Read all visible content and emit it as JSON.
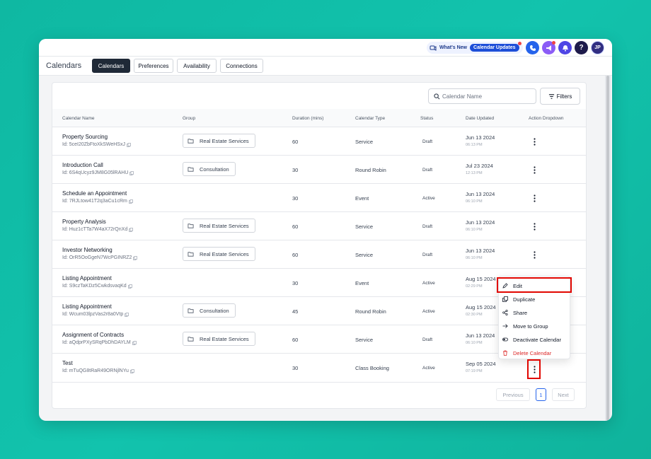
{
  "topbar": {
    "whats_new_label": "What's New",
    "updates_label": "Calendar Updates",
    "avatar_initials": "JP",
    "help_label": "?"
  },
  "header": {
    "title": "Calendars",
    "tabs": [
      {
        "label": "Calendars",
        "active": true
      },
      {
        "label": "Preferences",
        "active": false
      },
      {
        "label": "Availability",
        "active": false
      },
      {
        "label": "Connections",
        "active": false
      }
    ]
  },
  "toolbar": {
    "search_placeholder": "Calendar Name",
    "filters_label": "Filters"
  },
  "table": {
    "columns": [
      "Calendar Name",
      "Group",
      "Duration (mins)",
      "Calendar Type",
      "Status",
      "Date Updated",
      "Action Dropdown"
    ],
    "rows": [
      {
        "name": "Property Sourcing",
        "id": "Id: 5ceI20ZbFtoXkSWeHSxJ",
        "group": "Real Estate Services",
        "duration": "60",
        "type": "Service",
        "status": "Draft",
        "date": "Jun 13 2024",
        "time": "06:13 PM"
      },
      {
        "name": "Introduction Call",
        "id": "Id: 6S4qUcyz9JM8G05lRAHU",
        "group": "Consultation",
        "duration": "30",
        "type": "Round Robin",
        "status": "Draft",
        "date": "Jul 23 2024",
        "time": "12:13 PM"
      },
      {
        "name": "Schedule an Appointment",
        "id": "Id: 7RJLtow41T2q3aCu1cRm",
        "group": "",
        "duration": "30",
        "type": "Event",
        "status": "Active",
        "date": "Jun 13 2024",
        "time": "06:10 PM"
      },
      {
        "name": "Property Analysis",
        "id": "Id: Huz1cTTa7W4aX72rQnXd",
        "group": "Real Estate Services",
        "duration": "60",
        "type": "Service",
        "status": "Draft",
        "date": "Jun 13 2024",
        "time": "06:10 PM"
      },
      {
        "name": "Investor Networking",
        "id": "Id: OrR5OoGgeN7WcPGINRZ2",
        "group": "Real Estate Services",
        "duration": "60",
        "type": "Service",
        "status": "Draft",
        "date": "Jun 13 2024",
        "time": "06:10 PM"
      },
      {
        "name": "Listing Appointment",
        "id": "Id: S9czTaKDz5CwkdsvaqKd",
        "group": "",
        "duration": "30",
        "type": "Event",
        "status": "Active",
        "date": "Aug 15 2024",
        "time": "02:29 PM"
      },
      {
        "name": "Listing Appointment",
        "id": "Id: Wcum03lpzVas2r8a0Vtp",
        "group": "Consultation",
        "duration": "45",
        "type": "Round Robin",
        "status": "Active",
        "date": "Aug 15 2024",
        "time": "02:30 PM"
      },
      {
        "name": "Assignment of Contracts",
        "id": "Id: aQdprPXySRqPbDhDAYLM",
        "group": "Real Estate Services",
        "duration": "60",
        "type": "Service",
        "status": "Draft",
        "date": "Jun 13 2024",
        "time": "06:10 PM"
      },
      {
        "name": "Test",
        "id": "Id: mTuQG8tRaR49ORNjlNYu",
        "group": "",
        "duration": "30",
        "type": "Class Booking",
        "status": "Active",
        "date": "Sep 05 2024",
        "time": "07:19 PM"
      }
    ]
  },
  "pagination": {
    "previous": "Previous",
    "page": "1",
    "next": "Next"
  },
  "action_menu": {
    "items": [
      {
        "label": "Edit",
        "icon": "pencil-icon"
      },
      {
        "label": "Duplicate",
        "icon": "duplicate-icon"
      },
      {
        "label": "Share",
        "icon": "share-icon"
      },
      {
        "label": "Move to Group",
        "icon": "arrow-right-icon"
      },
      {
        "label": "Deactivate Calendar",
        "icon": "toggle-icon"
      },
      {
        "label": "Delete Calendar",
        "icon": "trash-icon"
      }
    ]
  },
  "colors": {
    "background": "#12c3ad",
    "highlight": "#e10600",
    "active_tab": "#1f2937",
    "accent": "#1d4ed8",
    "danger": "#dc2626"
  }
}
